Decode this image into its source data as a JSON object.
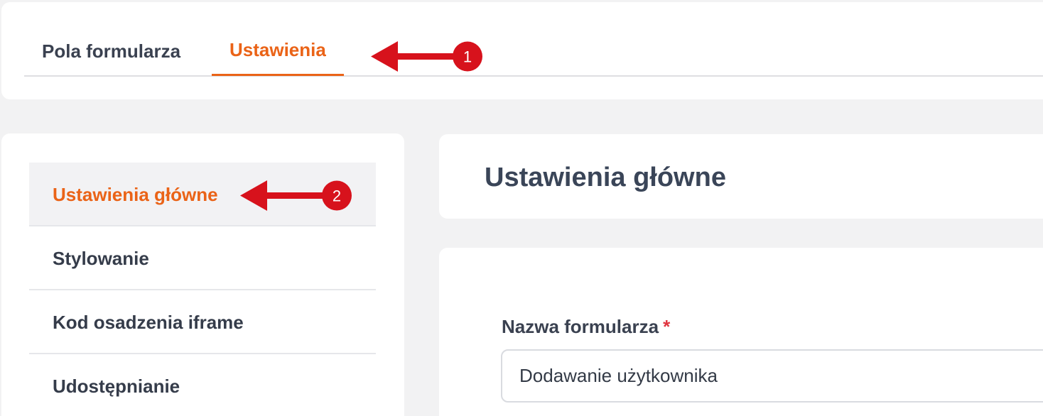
{
  "tabs": [
    {
      "label": "Pola formularza",
      "active": false
    },
    {
      "label": "Ustawienia",
      "active": true
    }
  ],
  "sidebar": {
    "items": [
      {
        "label": "Ustawienia główne",
        "active": true
      },
      {
        "label": "Stylowanie",
        "active": false
      },
      {
        "label": "Kod osadzenia iframe",
        "active": false
      },
      {
        "label": "Udostępnianie",
        "active": false
      }
    ]
  },
  "main": {
    "title": "Ustawienia główne",
    "form": {
      "name_label": "Nazwa formularza",
      "required_marker": "*",
      "name_value": "Dodawanie użytkownika"
    }
  },
  "annotations": [
    {
      "number": "1",
      "target": "tab Ustawienia"
    },
    {
      "number": "2",
      "target": "sidebar item Ustawienia główne"
    }
  ],
  "colors": {
    "accent": "#ea6317",
    "annotation": "#d7121c",
    "background": "#f2f2f3",
    "required": "#e0343f"
  }
}
